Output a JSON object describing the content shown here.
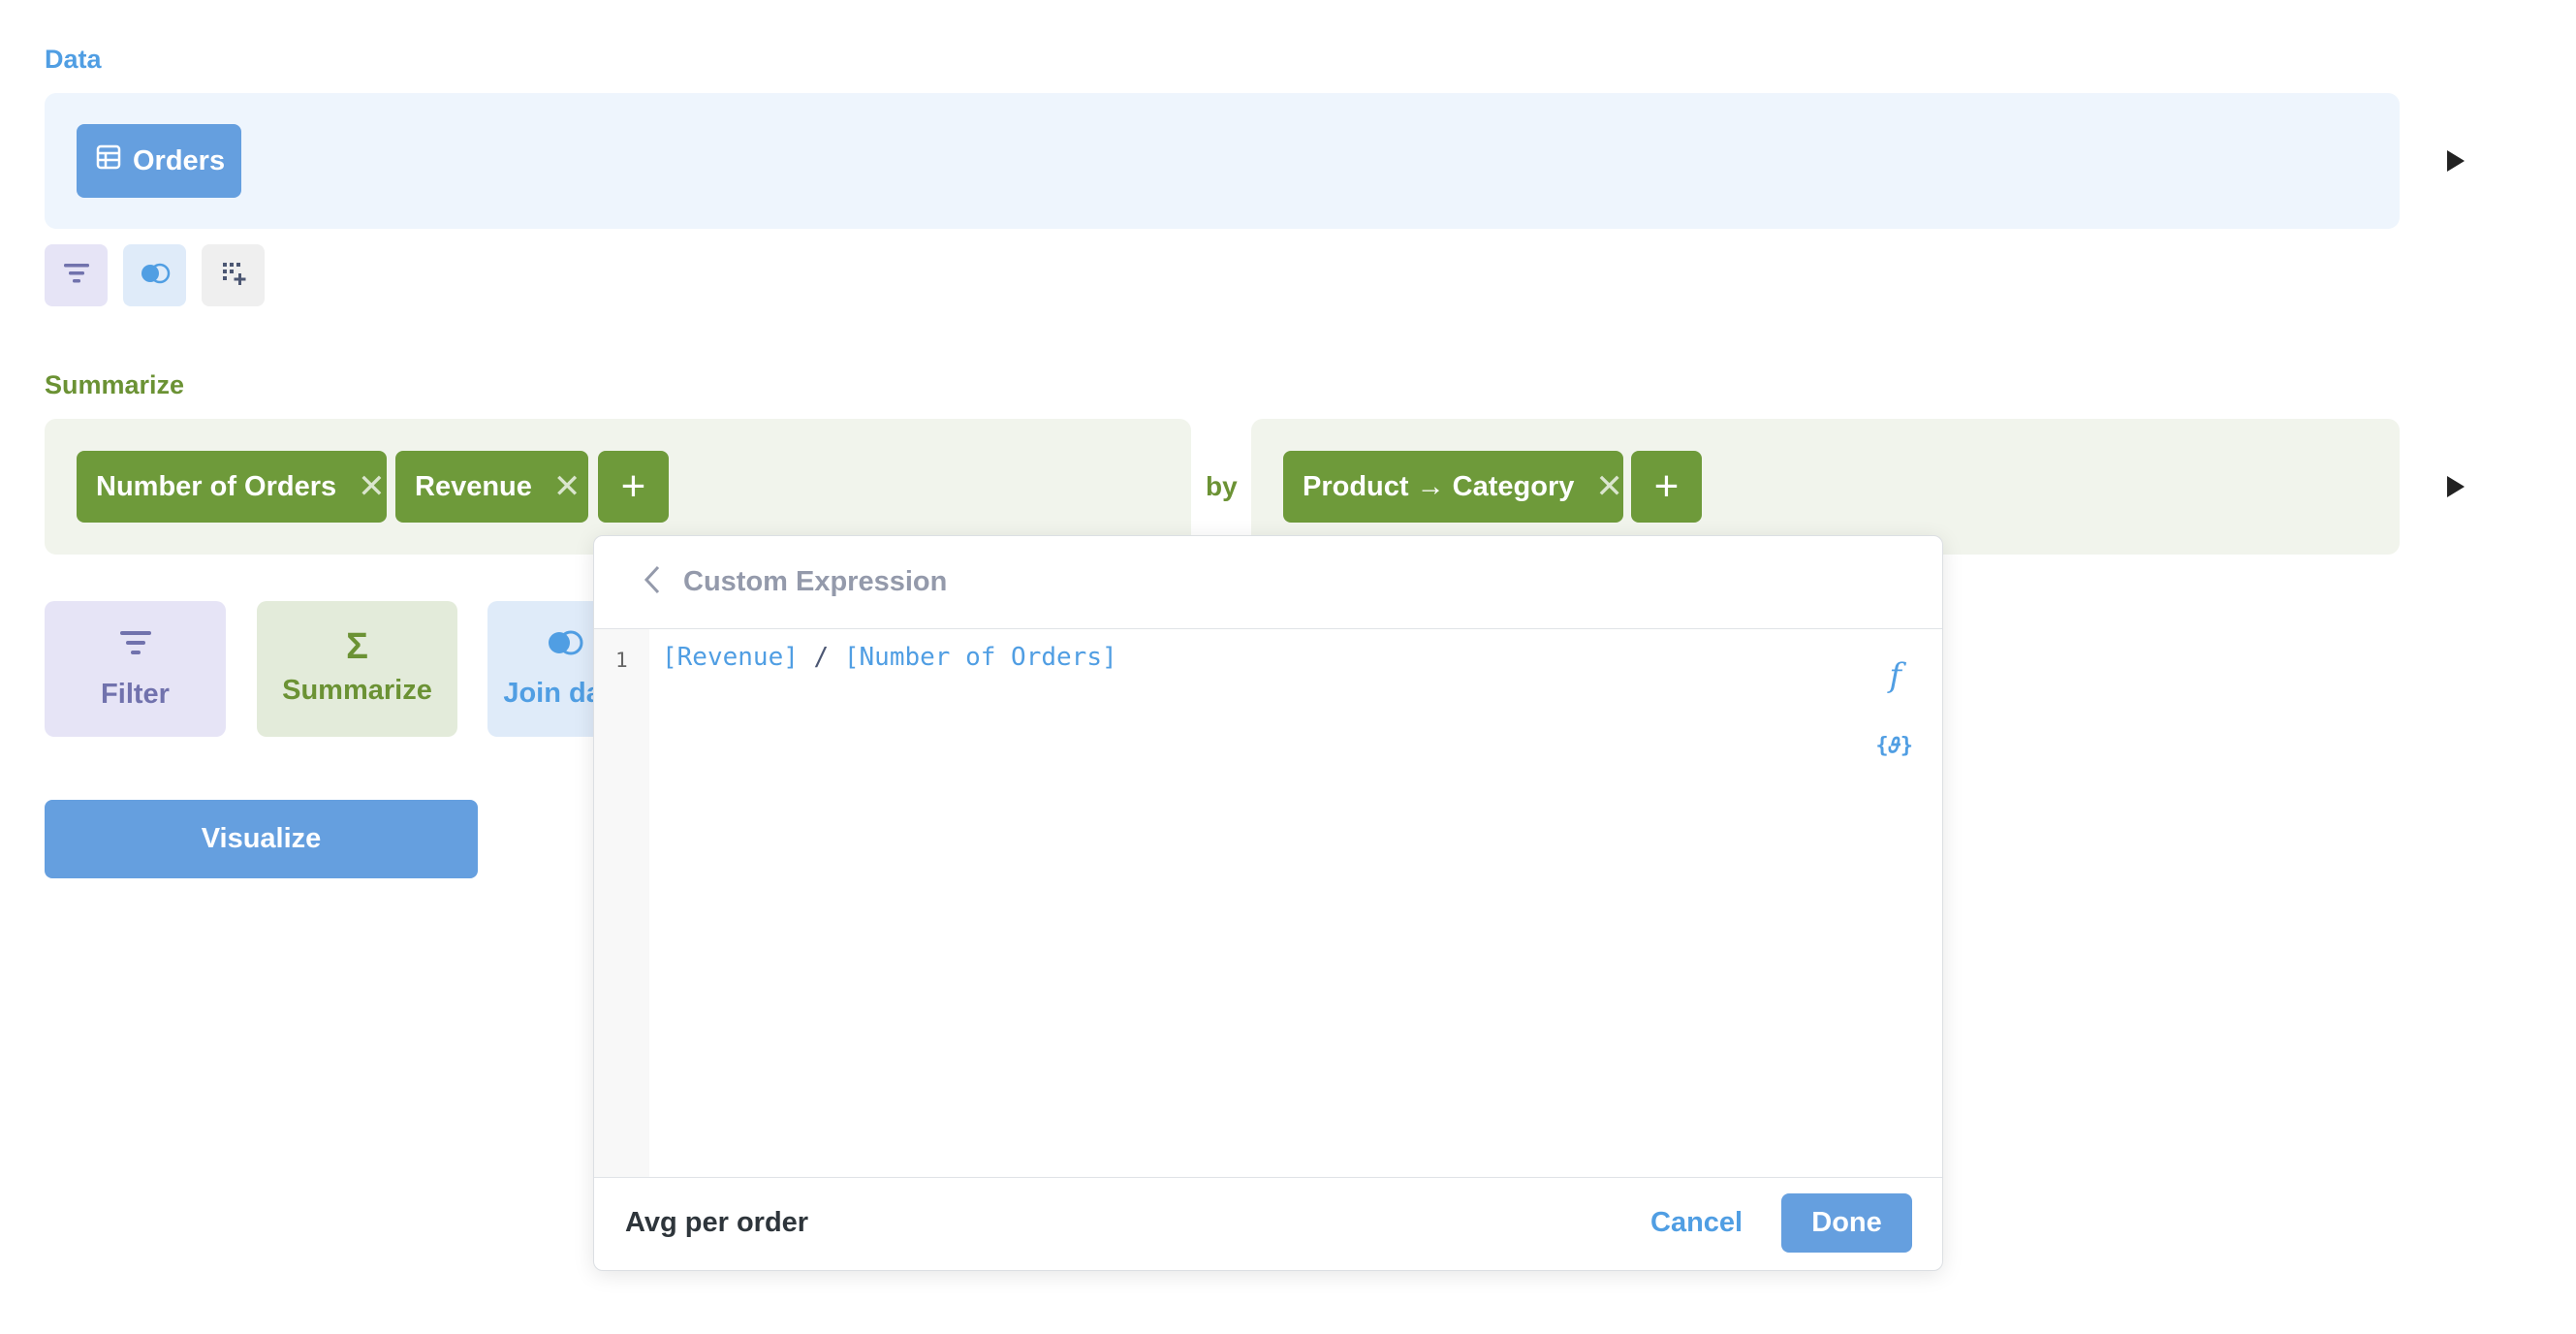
{
  "data_section": {
    "label": "Data",
    "table_label": "Orders",
    "table_icon": "table-icon"
  },
  "summarize_section": {
    "label": "Summarize",
    "metrics": [
      "Number of Orders",
      "Revenue"
    ],
    "by_label": "by",
    "breakouts": [
      "Product → Category"
    ]
  },
  "action_buttons": {
    "filter": "Filter",
    "summarize": "Summarize",
    "join": "Join data"
  },
  "visualize_label": "Visualize",
  "expression_editor": {
    "title": "Custom Expression",
    "line_number": "1",
    "code_token_1": "[Revenue]",
    "code_operator": " / ",
    "code_token_2": "[Number of Orders]",
    "function_icon_glyph": "f",
    "variable_icon_glyph": "{𝜗}",
    "name_value": "Avg per order",
    "cancel_label": "Cancel",
    "done_label": "Done"
  },
  "colors": {
    "data_accent": "#509ee3",
    "summarize_accent": "#6b9234",
    "filter_accent": "#7172ad"
  }
}
